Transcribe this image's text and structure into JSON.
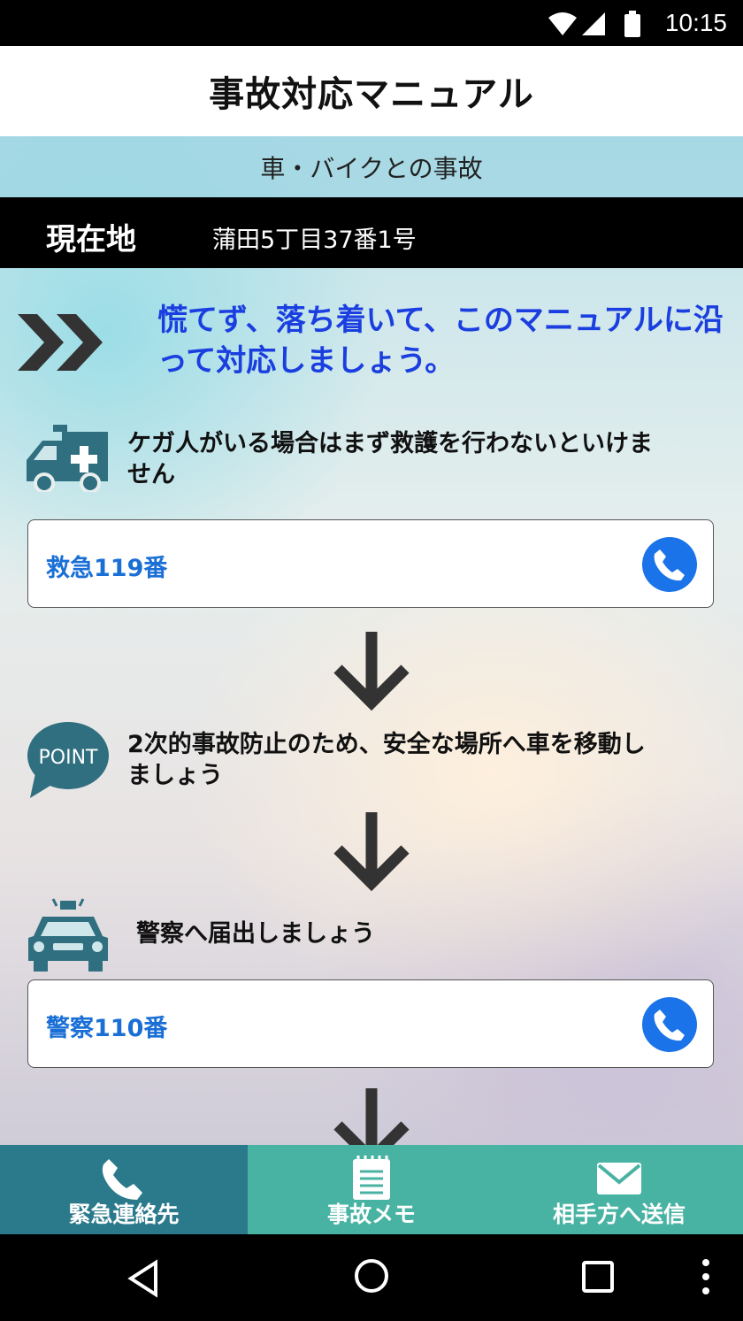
{
  "status_bar": {
    "time": "10:15",
    "icons": [
      "wifi-icon",
      "signal-icon",
      "battery-icon"
    ]
  },
  "app_bar": {
    "title": "事故対応マニュアル"
  },
  "subheader": {
    "text": "車・バイクとの事故"
  },
  "location": {
    "label": "現在地",
    "address": "蒲田5丁目37番1号"
  },
  "intro": {
    "message": "慌てず、落ち着いて、このマニュアルに沿って対応しましょう。"
  },
  "steps": [
    {
      "icon": "ambulance-icon",
      "text": "ケガ人がいる場合はまず救護を行わないといけません"
    },
    {
      "icon": "point-icon",
      "icon_label": "POINT",
      "text": "2次的事故防止のため、安全な場所へ車を移動しましょう"
    },
    {
      "icon": "police-car-icon",
      "text": "警察へ届出しましょう"
    }
  ],
  "calls": [
    {
      "label": "救急119番",
      "icon": "phone-icon"
    },
    {
      "label": "警察110番",
      "icon": "phone-icon"
    }
  ],
  "bottom_nav": [
    {
      "label": "緊急連絡先",
      "icon": "phone-icon",
      "color": "#2b7a8c"
    },
    {
      "label": "事故メモ",
      "icon": "memo-icon",
      "color": "#48b3a3"
    },
    {
      "label": "相手方へ送信",
      "icon": "mail-icon",
      "color": "#48b3a3"
    }
  ],
  "colors": {
    "accent_blue": "#1a3ee0",
    "phone_blue": "#1a73e8",
    "icon_teal": "#2f6f80"
  }
}
